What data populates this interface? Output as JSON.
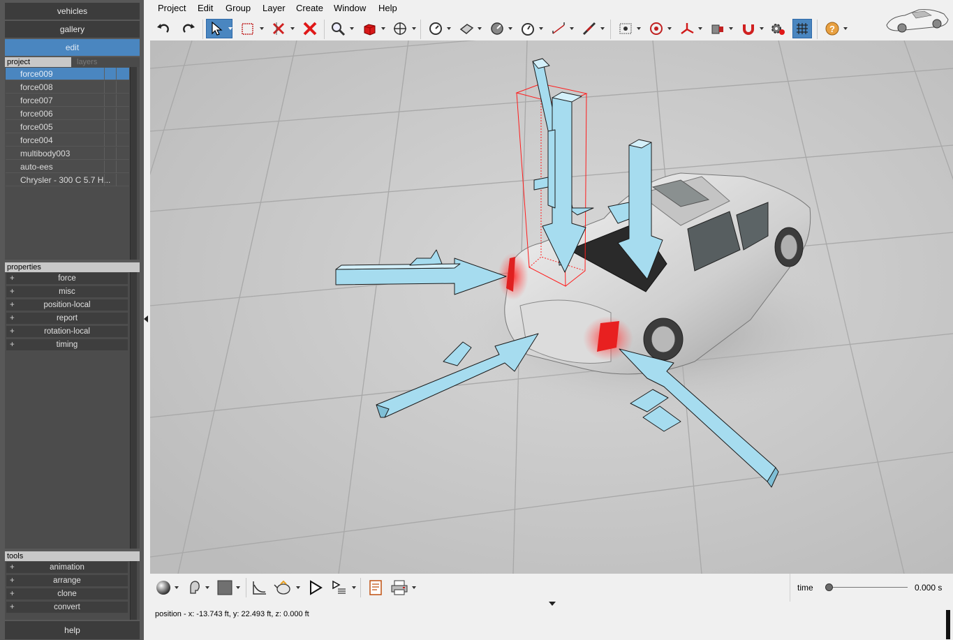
{
  "left": {
    "nav": {
      "vehicles": "vehicles",
      "gallery": "gallery",
      "edit": "edit",
      "help": "help"
    },
    "tabs": {
      "project": "project",
      "layers": "layers"
    },
    "project_items": [
      {
        "label": "force009",
        "selected": true
      },
      {
        "label": "force008"
      },
      {
        "label": "force007"
      },
      {
        "label": "force006"
      },
      {
        "label": "force005"
      },
      {
        "label": "force004"
      },
      {
        "label": "multibody003"
      },
      {
        "label": "auto-ees"
      },
      {
        "label": "Chrysler - 300 C 5.7 H..."
      }
    ],
    "properties_title": "properties",
    "properties": [
      "force",
      "misc",
      "position-local",
      "report",
      "rotation-local",
      "timing"
    ],
    "tools_title": "tools",
    "tools": [
      "animation",
      "arrange",
      "clone",
      "convert"
    ],
    "plus": "+"
  },
  "menu": [
    "Project",
    "Edit",
    "Group",
    "Layer",
    "Create",
    "Window",
    "Help"
  ],
  "toolbar_icons": [
    "undo-icon",
    "redo-icon",
    "select-arrow-icon",
    "select-box-icon",
    "delete-multiple-icon",
    "delete-icon",
    "zoom-icon",
    "box-object-icon",
    "move-icon",
    "gauge-icon",
    "surface-icon",
    "dial-icon",
    "timer-icon",
    "measure-icon",
    "probe-icon",
    "frame-icon",
    "target-icon",
    "axes-icon",
    "camera-icon",
    "magnet-icon",
    "settings-icon",
    "grid-icon",
    "help-icon"
  ],
  "viewport": {
    "scene": "3D view of car with force arrows",
    "bg": "#c9c9c9",
    "arrow_color": "#a6dcef"
  },
  "bottom": {
    "time_label": "time",
    "time_value": "0.000 s",
    "time_fraction": 0,
    "status": "position - x: -13.743 ft, y: 22.493 ft, z: 0.000 ft"
  },
  "colors": {
    "accent": "#4a86c0",
    "panel": "#585858",
    "selection_box": "#ff2020"
  }
}
